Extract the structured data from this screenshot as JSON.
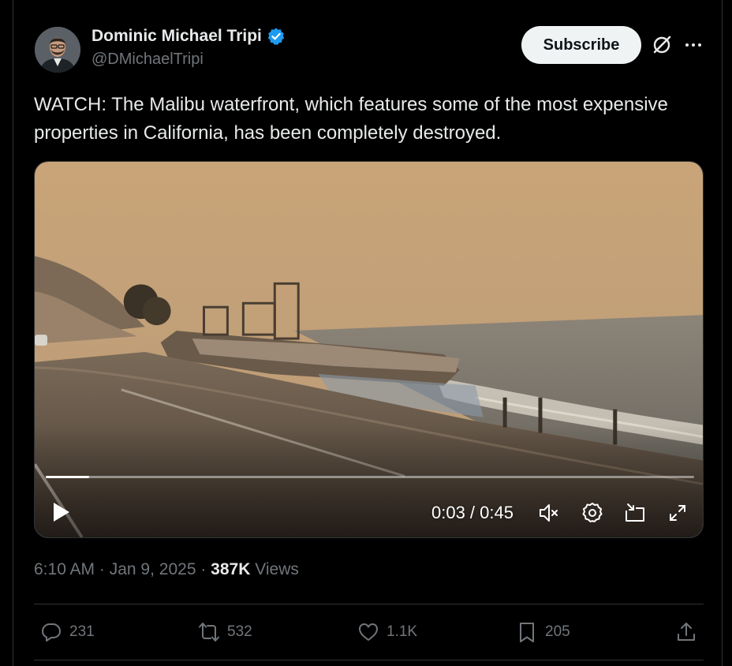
{
  "author": {
    "display_name": "Dominic Michael Tripi",
    "handle": "@DMichaelTripi",
    "verified": true,
    "verified_color": "#1d9bf0"
  },
  "header": {
    "subscribe_label": "Subscribe",
    "grok_icon": "grok-icon",
    "more_icon": "more-icon"
  },
  "tweet": {
    "text": "WATCH: The Malibu waterfront, which features some of the most expensive properties in California, has been completely destroyed."
  },
  "video": {
    "current_time": "0:03",
    "duration": "0:45",
    "time_display": "0:03 / 0:45",
    "progress_fraction": 0.067,
    "controls": [
      "play-icon",
      "mute-icon",
      "settings-icon",
      "pip-icon",
      "fullscreen-icon"
    ]
  },
  "meta": {
    "time": "6:10 AM",
    "date": "Jan 9, 2025",
    "views_count": "387K",
    "views_label": "Views"
  },
  "actions": {
    "replies": "231",
    "reposts": "532",
    "likes": "1.1K",
    "bookmarks": "205"
  },
  "colors": {
    "background": "#000000",
    "text_primary": "#e7e9ea",
    "text_secondary": "#71767b",
    "divider": "#2f3336",
    "button_bg": "#eff3f4"
  }
}
